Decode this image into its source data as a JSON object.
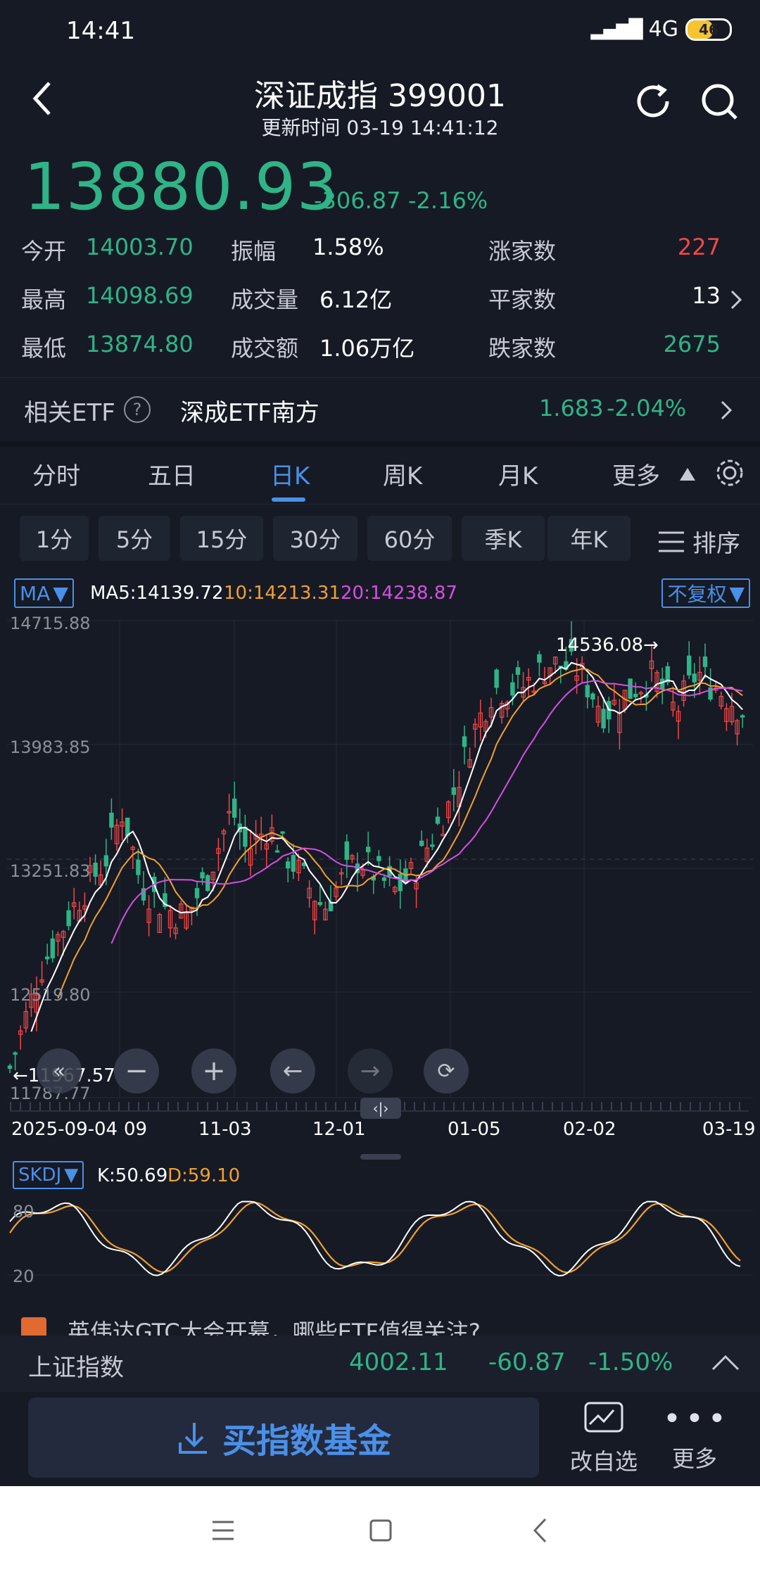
{
  "status": {
    "time": "14:41",
    "network": "4G",
    "battery": "46"
  },
  "header": {
    "title": "深证成指 399001",
    "subtitle": "更新时间 03-19 14:41:12"
  },
  "quote": {
    "price": "13880.93",
    "change": "-306.87",
    "pct": "-2.16%",
    "rows": [
      {
        "l1": "今开",
        "v1": "14003.70",
        "l2": "振幅",
        "v2": "1.58%",
        "l3": "涨家数",
        "v3": "227"
      },
      {
        "l1": "最高",
        "v1": "14098.69",
        "l2": "成交量",
        "v2": "6.12亿",
        "l3": "平家数",
        "v3": "13"
      },
      {
        "l1": "最低",
        "v1": "13874.80",
        "l2": "成交额",
        "v2": "1.06万亿",
        "l3": "跌家数",
        "v3": "2675"
      }
    ]
  },
  "etf": {
    "label": "相关ETF",
    "help": "?",
    "name": "深成ETF南方",
    "price": "1.683",
    "pct": "-2.04%"
  },
  "tabs": [
    "分时",
    "五日",
    "日K",
    "周K",
    "月K",
    "更多"
  ],
  "periods": [
    "1分",
    "5分",
    "15分",
    "30分",
    "60分",
    "季K",
    "年K"
  ],
  "sort_label": "排序",
  "ma": {
    "btn": "MA",
    "ma5": "MA5:14139.72",
    "ma10": "10:14213.31",
    "ma20": "20:14238.87",
    "adjust": "不复权"
  },
  "kline": {
    "ylabels": [
      "14715.88",
      "13983.85",
      "13251.83",
      "12519.80",
      "11787.77"
    ],
    "max_label": "14536.08→",
    "min_label": "←11967.57",
    "xlabels": [
      "2025-09-04",
      "09",
      "11-03",
      "12-01",
      "01-05",
      "02-02",
      "03-19"
    ],
    "scroll_handle": "‹|›"
  },
  "skdj": {
    "btn": "SKDJ",
    "k": "K:50.69",
    "d": "D:59.10",
    "ylabels": [
      "80",
      "20"
    ]
  },
  "news": {
    "text": "英伟达GTC大会开幕，哪些ETF值得关注?"
  },
  "ticker": {
    "name": "上证指数",
    "price": "4002.11",
    "change": "-60.87",
    "pct": "-1.50%"
  },
  "bottom": {
    "buy": "买指数基金",
    "watch": "改自选",
    "more": "更多"
  },
  "colors": {
    "bg": "#161a25",
    "up": "#f04848",
    "down": "#2fb487",
    "accent": "#4a90e8",
    "ma5": "#ffffff",
    "ma10": "#f0a030",
    "ma20": "#d54fe0"
  }
}
